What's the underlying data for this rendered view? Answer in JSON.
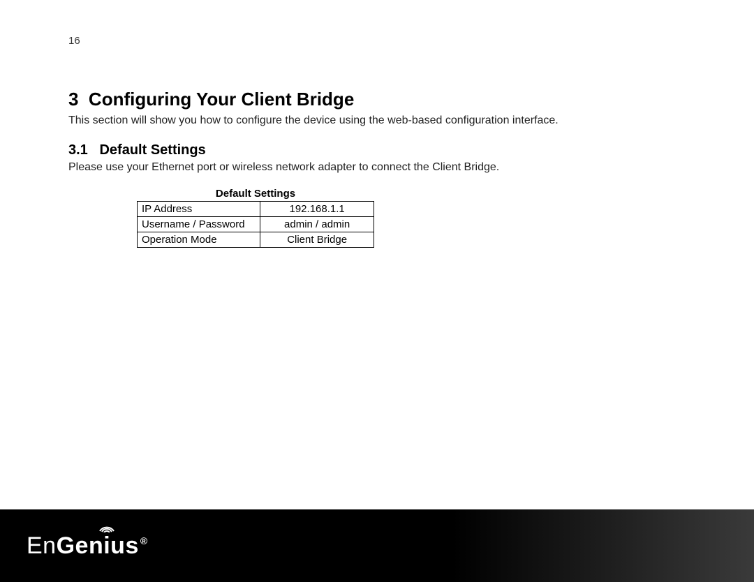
{
  "page_number": "16",
  "heading_number": "3",
  "heading_text": "Configuring Your Client Bridge",
  "intro_text": "This section will show you how to configure the device using the web-based configuration interface.",
  "sub_number": "3.1",
  "sub_text": "Default Settings",
  "sub_intro": "Please use your Ethernet port or wireless network adapter to connect the Client Bridge.",
  "table_title": "Default Settings",
  "rows": [
    {
      "key": "IP Address",
      "val": "192.168.1.1"
    },
    {
      "key": "Username / Password",
      "val": "admin / admin"
    },
    {
      "key": "Operation Mode",
      "val": "Client Bridge"
    }
  ],
  "logo": {
    "part1": "En",
    "part2": "Gen",
    "part3_i": "i",
    "part4": "us",
    "reg": "®"
  }
}
